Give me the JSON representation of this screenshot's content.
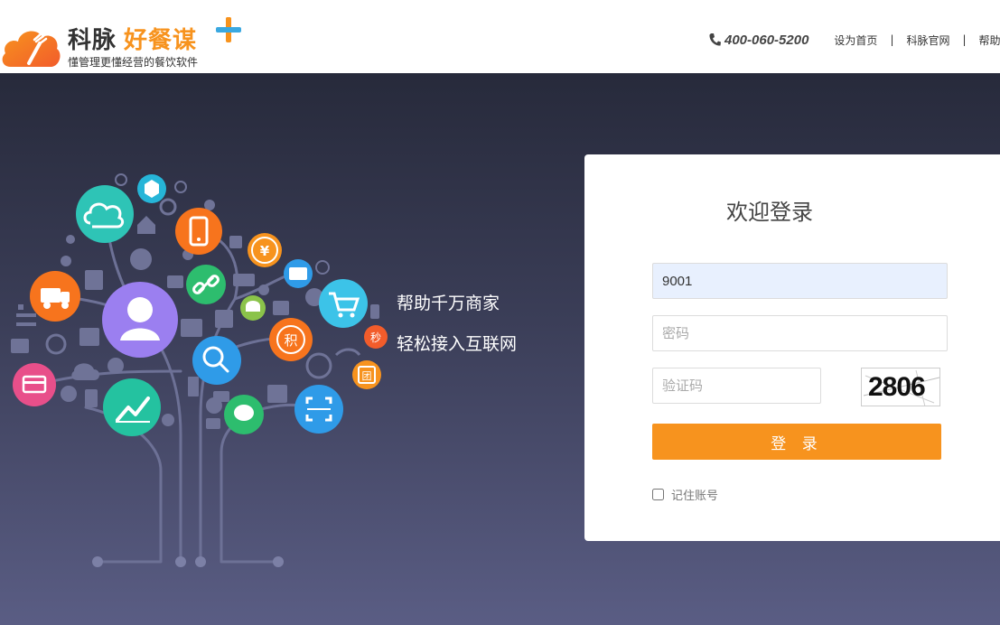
{
  "header": {
    "brand_main": "科脉",
    "brand_accent": "好餐谋",
    "slogan": "懂管理更懂经营的餐饮软件",
    "phone": "400-060-5200",
    "links": [
      "设为首页",
      "科脉官网",
      "帮助"
    ],
    "separator": "|"
  },
  "banner": {
    "tagline_line1": "帮助千万商家",
    "tagline_line2": "轻松接入互联网",
    "tree_badges": {
      "points": "积",
      "flash": "秒",
      "group": "团",
      "yen": "¥"
    }
  },
  "login": {
    "title": "欢迎登录",
    "username_value": "9001",
    "password_placeholder": "密码",
    "captcha_placeholder": "验证码",
    "captcha_code": "2806",
    "submit_label": "登 录",
    "remember_label": "记住账号"
  },
  "colors": {
    "accent": "#f7931e",
    "banner_top": "#272a3b",
    "banner_bottom": "#5a5d84",
    "autofill": "#e8f0fe"
  },
  "icons": [
    "cloud-fork-logo-icon",
    "plus-icon",
    "phone-icon",
    "cloud-icon",
    "phone-device-icon",
    "cube-icon",
    "truck-icon",
    "user-icon",
    "link-icon",
    "yen-icon",
    "cart-icon",
    "search-icon",
    "chart-icon",
    "card-icon",
    "chat-icon",
    "scan-icon",
    "points-icon",
    "flash-sale-icon",
    "group-buy-icon"
  ]
}
